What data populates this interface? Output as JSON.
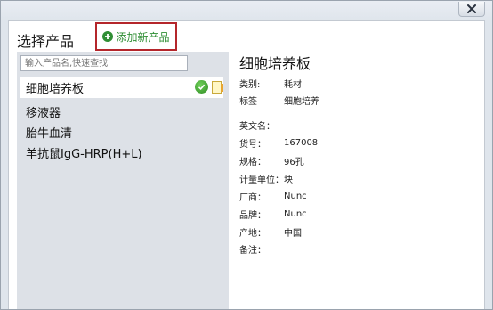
{
  "dialog": {
    "title": "选择产品",
    "add_button_label": "添加新产品"
  },
  "search": {
    "placeholder": "输入产品名,快速查找",
    "value": ""
  },
  "products": [
    {
      "name": "细胞培养板",
      "selected": true
    },
    {
      "name": "移液器",
      "selected": false
    },
    {
      "name": "胎牛血清",
      "selected": false
    },
    {
      "name": "羊抗鼠IgG-HRP(H+L)",
      "selected": false
    }
  ],
  "detail": {
    "title": "细胞培养板",
    "fields": [
      {
        "key": "类别:",
        "value": "耗材"
      },
      {
        "key": "标签",
        "value": "细胞培养"
      },
      {
        "key": "英文名：",
        "value": ""
      },
      {
        "key": "货号：",
        "value": "167008"
      },
      {
        "key": "规格：",
        "value": "96孔"
      },
      {
        "key": "计量单位：",
        "value": "块"
      },
      {
        "key": "厂商：",
        "value": "Nunc"
      },
      {
        "key": "品牌：",
        "value": "Nunc"
      },
      {
        "key": "产地：",
        "value": "中国"
      },
      {
        "key": "备注：",
        "value": ""
      }
    ]
  },
  "colors": {
    "accent_green": "#2f8e34",
    "highlight_red": "#b4262b",
    "panel_bg": "#dde1e7"
  }
}
